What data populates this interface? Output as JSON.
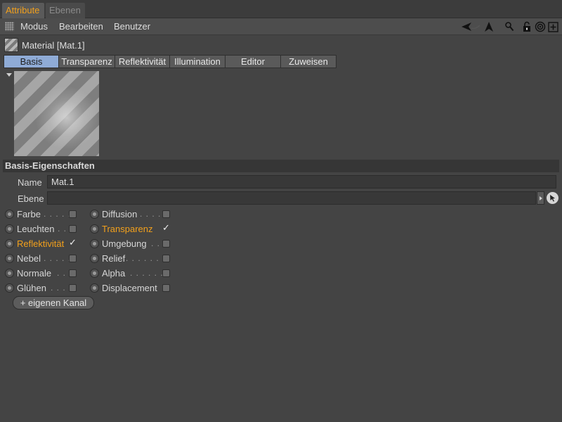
{
  "tabs": [
    {
      "label": "Attribute",
      "active": true
    },
    {
      "label": "Ebenen",
      "active": false
    }
  ],
  "menu": {
    "items": [
      "Modus",
      "Bearbeiten",
      "Benutzer"
    ],
    "icons": [
      "back-arrow-icon",
      "cursor-arrow-icon",
      "search-icon",
      "lock-icon",
      "target-icon",
      "new-panel-icon"
    ]
  },
  "material": {
    "title": "Material [Mat.1]"
  },
  "page_tabs": [
    {
      "label": "Basis",
      "selected": true
    },
    {
      "label": "Transparenz",
      "selected": false
    },
    {
      "label": "Reflektivität",
      "selected": false
    },
    {
      "label": "Illumination",
      "selected": false
    },
    {
      "label": "Editor",
      "selected": false
    },
    {
      "label": "Zuweisen",
      "selected": false
    }
  ],
  "section": {
    "title": "Basis-Eigenschaften"
  },
  "fields": {
    "name_label": "Name",
    "name_value": "Mat.1",
    "ebene_label": "Ebene",
    "ebene_value": ""
  },
  "channels_left": [
    {
      "label": "Farbe",
      "dots": ". . . . .",
      "checked": false,
      "highlight": false
    },
    {
      "label": "Leuchten",
      "dots": ". .",
      "checked": false,
      "highlight": false
    },
    {
      "label": "Reflektivität",
      "dots": "",
      "checked": true,
      "highlight": true
    },
    {
      "label": "Nebel",
      "dots": ". . . . .",
      "checked": false,
      "highlight": false
    },
    {
      "label": "Normale",
      "dots": ". .",
      "checked": false,
      "highlight": false
    },
    {
      "label": "Glühen",
      "dots": ". . . .",
      "checked": false,
      "highlight": false
    }
  ],
  "channels_right": [
    {
      "label": "Diffusion",
      "dots": ". . . . .",
      "checked": false,
      "highlight": false
    },
    {
      "label": "Transparenz",
      "dots": "",
      "checked": true,
      "highlight": true
    },
    {
      "label": "Umgebung",
      "dots": ". .",
      "checked": false,
      "highlight": false
    },
    {
      "label": "Relief",
      "dots": ". . . . . . . .",
      "checked": false,
      "highlight": false
    },
    {
      "label": "Alpha",
      "dots": ". . . . . . .",
      "checked": false,
      "highlight": false
    },
    {
      "label": "Displacement",
      "dots": "",
      "checked": false,
      "highlight": false
    }
  ],
  "add_channel": {
    "label": "+ eigenen Kanal"
  },
  "colors": {
    "accent": "#f2a01c",
    "tab_selected": "#8fabd6",
    "background": "#444444"
  }
}
